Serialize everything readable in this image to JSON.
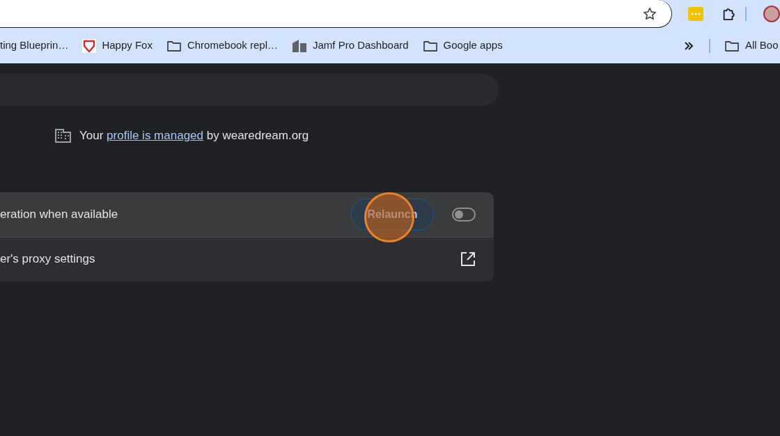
{
  "bookmarks": [
    {
      "label": "ting Blueprin…",
      "kind": "none"
    },
    {
      "label": "Happy Fox",
      "kind": "shield"
    },
    {
      "label": "Chromebook repl…",
      "kind": "folder"
    },
    {
      "label": "Jamf Pro Dashboard",
      "kind": "tile"
    },
    {
      "label": "Google apps",
      "kind": "folder"
    }
  ],
  "all_bookmarks": {
    "label": "All Boo"
  },
  "managed_notice": {
    "text_before": "Your",
    "link": "profile is managed",
    "text_after": "by wearedream.org"
  },
  "settings": [
    {
      "kind": "toggle",
      "label": "eration when available",
      "button": "Relaunch",
      "on": false,
      "highlighted": true
    },
    {
      "kind": "external",
      "label": "er's proxy settings",
      "highlighted": false
    }
  ]
}
